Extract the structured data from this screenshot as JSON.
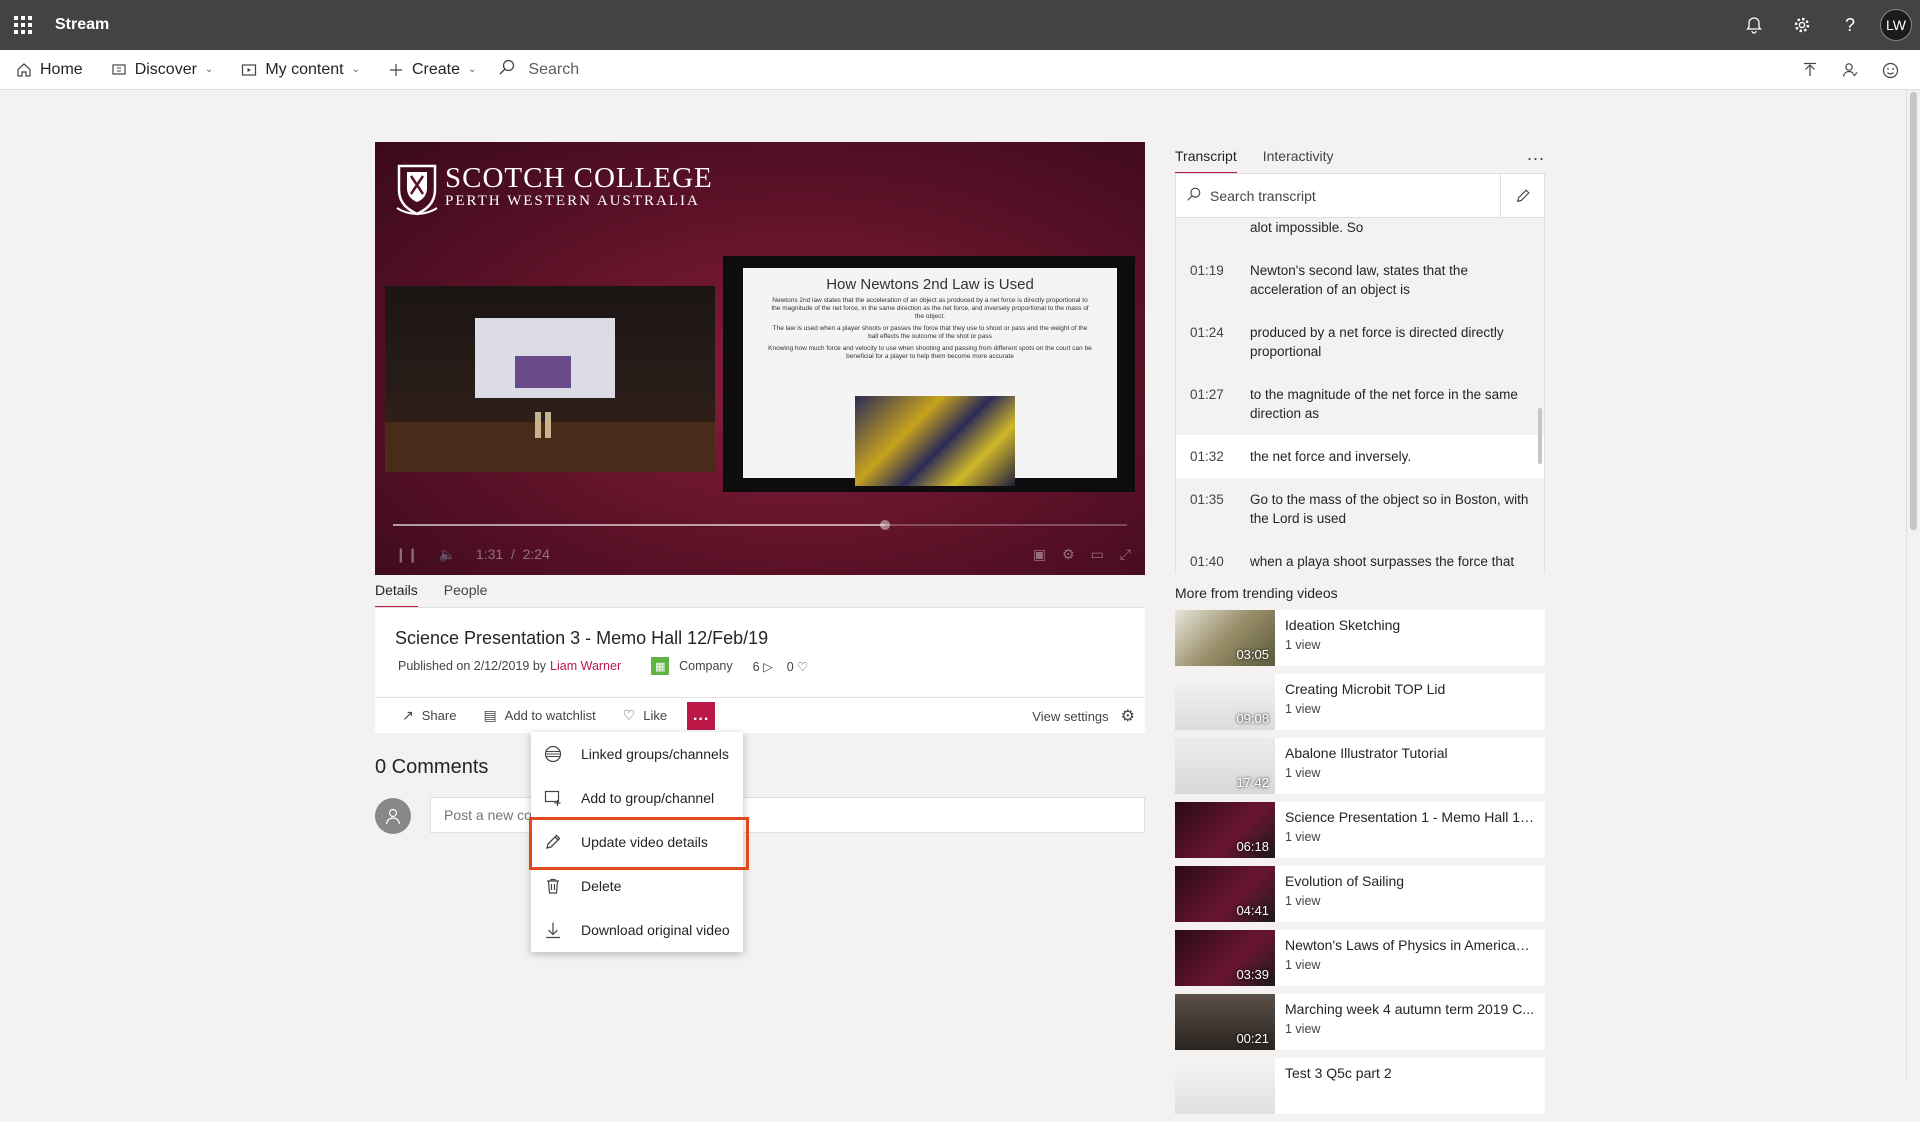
{
  "app": {
    "title": "Stream",
    "user_initials": "LW"
  },
  "appbar_icons": [
    "bell-icon",
    "gear-icon",
    "help-icon"
  ],
  "nav": {
    "home": "Home",
    "discover": "Discover",
    "my_content": "My content",
    "create": "Create",
    "search_placeholder": "Search"
  },
  "player": {
    "school_name": "SCOTCH COLLEGE",
    "school_location": "PERTH WESTERN AUSTRALIA",
    "slide_title": "How Newtons 2nd Law is Used",
    "slide_bullets": [
      "Newtons 2nd law states that the acceleration of an object as produced by a net force is directly proportional to the magnitude of the net force, in the same direction as the net force, and inversely proportional to the mass of the object.",
      "The law is used when a player shoots or passes the force that they use to shoot or pass and the weight of the ball effects the outcome of the shot or pass",
      "Knowing how much force and velocity to use when shooting and passing from different spots on the court can be beneficial for a player to help them become more accurate"
    ],
    "current_time": "1:31",
    "time_separator": "/",
    "duration": "2:24",
    "progress_fraction": 0.67
  },
  "details": {
    "tabs": [
      "Details",
      "People"
    ],
    "title": "Science Presentation 3 - Memo Hall 12/Feb/19",
    "published": "Published on 2/12/2019 by",
    "author": "Liam Warner",
    "audience": "Company",
    "views": "6",
    "likes": "0"
  },
  "actions": {
    "share": "Share",
    "watchlist": "Add to watchlist",
    "like": "Like",
    "more": "...",
    "view_settings": "View settings"
  },
  "comments": {
    "title": "0 Comments",
    "placeholder": "Post a new comment"
  },
  "menu": {
    "items": [
      {
        "label": "Linked groups/channels",
        "icon": "linked-groups-icon"
      },
      {
        "label": "Add to group/channel",
        "icon": "add-group-icon"
      },
      {
        "label": "Update video details",
        "icon": "pencil-icon"
      },
      {
        "label": "Delete",
        "icon": "trash-icon"
      },
      {
        "label": "Download original video",
        "icon": "download-icon"
      }
    ],
    "highlighted_index": 2
  },
  "right_panel": {
    "tabs": [
      "Transcript",
      "Interactivity"
    ],
    "more": "...",
    "search_placeholder": "Search transcript",
    "transcript": [
      {
        "time": "",
        "text": "alot impossible. So"
      },
      {
        "time": "01:19",
        "text": "Newton's second law, states that the acceleration of an object is"
      },
      {
        "time": "01:24",
        "text": "produced by a net force is directed directly proportional"
      },
      {
        "time": "01:27",
        "text": "to the magnitude of the net force in the same direction as"
      },
      {
        "time": "01:32",
        "text": "the net force and inversely."
      },
      {
        "time": "01:35",
        "text": "Go to the mass of the object so in Boston, with the Lord is used"
      },
      {
        "time": "01:40",
        "text": "when a playa shoot surpasses the force that they use with the"
      }
    ],
    "current_index": 4,
    "trending_title": "More from trending videos",
    "trending": [
      {
        "name": "Ideation Sketching",
        "views": "1 view",
        "duration": "03:05"
      },
      {
        "name": "Creating Microbit TOP Lid",
        "views": "1 view",
        "duration": "09:08"
      },
      {
        "name": "Abalone Illustrator Tutorial",
        "views": "1 view",
        "duration": "17:42"
      },
      {
        "name": "Science Presentation 1 - Memo Hall 12...",
        "views": "1 view",
        "duration": "06:18"
      },
      {
        "name": "Evolution of Sailing",
        "views": "1 view",
        "duration": "04:41"
      },
      {
        "name": "Newton's Laws of Physics in American ...",
        "views": "1 view",
        "duration": "03:39"
      },
      {
        "name": "Marching week 4 autumn term 2019 C...",
        "views": "1 view",
        "duration": "00:21"
      },
      {
        "name": "Test 3 Q5c part 2",
        "views": "",
        "duration": ""
      }
    ]
  },
  "colors": {
    "accent": "#bc1948",
    "appbar": "#444343",
    "highlight": "#e0491c"
  }
}
